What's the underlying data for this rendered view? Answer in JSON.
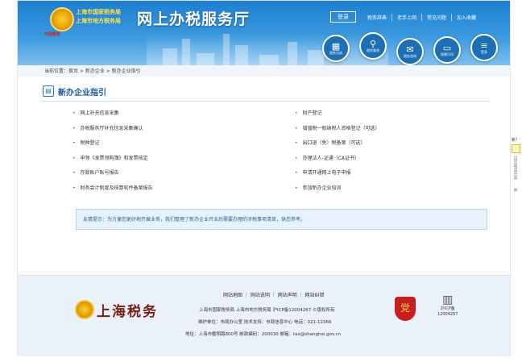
{
  "header": {
    "org_line1": "上海市国家税务局",
    "org_line2": "上海市地方税务局",
    "emblem_caption": "中国税务",
    "site_title": "网上办税服务厅",
    "login_label": "登录",
    "nav": [
      "税务辞典",
      "老手上网",
      "常见问题",
      "加入收藏"
    ],
    "circles": [
      {
        "icon": "building-icon",
        "glyph": "▦",
        "label": "税务分局"
      },
      {
        "icon": "search-icon",
        "glyph": "⚲",
        "label": "税务查询"
      },
      {
        "icon": "chat-icon",
        "glyph": "✉",
        "label": "税务咨询"
      },
      {
        "icon": "monitor-icon",
        "glyph": "▭",
        "label": "税票打印"
      },
      {
        "icon": "menu-icon",
        "glyph": "≡",
        "label": "更多"
      }
    ]
  },
  "breadcrumb": "当前位置：首页 > 新办企业 > 新办企业指引",
  "section": {
    "title": "新办企业指引",
    "left_links": [
      "网上补充信息采集",
      "办税服务厅补充信息采集确认",
      "税种登记",
      "申领《发票领购簿》和发票核定",
      "存款账户账号报告",
      "财务会计制度及核算软件备案报告"
    ],
    "right_links": [
      "财产登记",
      "增值税一般纳税人资格登记（可选）",
      "出口退（免）税备案（可选）",
      "办理法人-证通（CA证书）",
      "申请开通网上电子申报",
      "参加新办企业培训"
    ],
    "tip": "友情提示：为方便您更好地开展业务，我们整理了新办企业开业后需要办理的涉税事项清单，供您参考。"
  },
  "footer": {
    "logo_text": "上海税务",
    "links": [
      "网站地图",
      "网站说明",
      "网站声明",
      "网站纠错"
    ],
    "line1": "上海市国家税务局 上海市地方税务局 沪ICP备12004267 ©版权所有",
    "line2": "维护单位：市局办公室  技术支持：市局信息中心 电话：021-12366",
    "line3": "地址：上海市衢翔路800号  邮政编码：200030  邮箱：tax@shanghai.gov.cn",
    "badge_glyph": "党",
    "icp_label1": "沪ICP备",
    "icp_label2": "12004267"
  },
  "side_tab": {
    "label": "新！",
    "text": "日贝电话分享",
    "close": "×"
  }
}
